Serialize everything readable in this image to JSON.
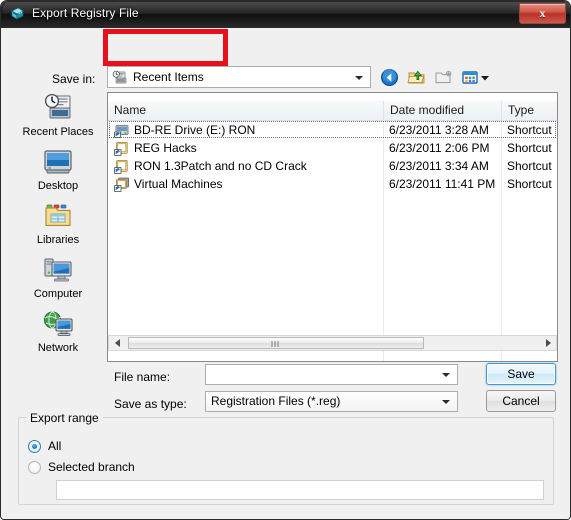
{
  "window": {
    "title": "Export Registry File",
    "title_icon": "registry-editor-icon",
    "close_label": "x"
  },
  "savein": {
    "label": "Save in:",
    "value": "Recent Items",
    "icon": "recent-items-icon"
  },
  "toolbar": {
    "buttons": [
      {
        "name": "back-button",
        "icon": "back-arrow-icon",
        "enabled": true
      },
      {
        "name": "up-one-level-button",
        "icon": "up-folder-icon",
        "enabled": true
      },
      {
        "name": "new-folder-button",
        "icon": "new-folder-icon",
        "enabled": false
      },
      {
        "name": "views-button",
        "icon": "views-icon",
        "enabled": true
      }
    ]
  },
  "places": [
    {
      "label": "Recent Places",
      "icon": "recent-places-icon"
    },
    {
      "label": "Desktop",
      "icon": "desktop-icon"
    },
    {
      "label": "Libraries",
      "icon": "libraries-icon"
    },
    {
      "label": "Computer",
      "icon": "computer-icon"
    },
    {
      "label": "Network",
      "icon": "network-icon"
    }
  ],
  "filelist": {
    "columns": [
      "Name",
      "Date modified",
      "Type"
    ],
    "sort_column": "Name",
    "sort_direction": "ascending",
    "rows": [
      {
        "name": "BD-RE Drive (E:) RON",
        "date": "6/23/2011 3:28 AM",
        "type": "Shortcut",
        "focused": true
      },
      {
        "name": "REG Hacks",
        "date": "6/23/2011 2:06 PM",
        "type": "Shortcut",
        "focused": false
      },
      {
        "name": "RON 1.3Patch and no CD Crack",
        "date": "6/23/2011 3:34 AM",
        "type": "Shortcut",
        "focused": false
      },
      {
        "name": "Virtual Machines",
        "date": "6/23/2011 11:41 PM",
        "type": "Shortcut",
        "focused": false
      }
    ]
  },
  "form": {
    "filename_label": "File name:",
    "filename_value": "",
    "savetype_label": "Save as type:",
    "savetype_value": "Registration Files (*.reg)",
    "save_button": "Save",
    "cancel_button": "Cancel"
  },
  "export_range": {
    "group_title": "Export range",
    "options": [
      {
        "label": "All",
        "selected": true
      },
      {
        "label": "Selected branch",
        "selected": false
      }
    ],
    "branch_value": ""
  },
  "annotation": {
    "shape": "rectangle",
    "color": "#e8101b",
    "target": "Recent Items"
  }
}
